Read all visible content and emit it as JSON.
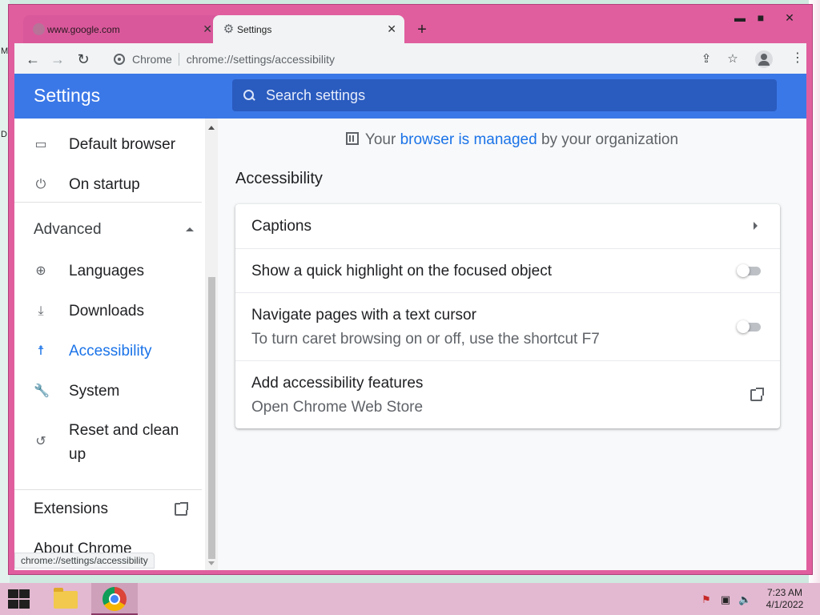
{
  "browser": {
    "tabs": [
      {
        "label": "www.google.com",
        "close": "✕"
      },
      {
        "label": "Settings",
        "close": "✕"
      }
    ],
    "new_tab": "+",
    "window_controls": {
      "minimize": "▬",
      "maximize": "■",
      "close": "✕"
    },
    "nav": {
      "back": "←",
      "forward": "→",
      "reload": "↻"
    },
    "omnibox": {
      "chip": "Chrome",
      "url": "chrome://settings/accessibility"
    },
    "actions": {
      "share": "⇪",
      "bookmark": "☆",
      "menu": "⋮"
    },
    "status_url": "chrome://settings/accessibility"
  },
  "settings": {
    "title": "Settings",
    "search_placeholder": "Search settings"
  },
  "sidebar": {
    "items": [
      {
        "label": "Default browser",
        "icon": "browser-window-icon",
        "glyph": "▭"
      },
      {
        "label": "On startup",
        "icon": "power-icon",
        "glyph": "⏻"
      },
      {
        "label": "Languages",
        "icon": "globe-icon",
        "glyph": "⊕"
      },
      {
        "label": "Downloads",
        "icon": "download-icon",
        "glyph": "⤓"
      },
      {
        "label": "Accessibility",
        "icon": "accessibility-icon",
        "glyph": "☨"
      },
      {
        "label": "System",
        "icon": "wrench-icon",
        "glyph": "🔧"
      },
      {
        "label": "Reset and clean",
        "label2": "up",
        "icon": "history-reset-icon",
        "glyph": "↺"
      }
    ],
    "advanced_label": "Advanced",
    "extensions_label": "Extensions",
    "about_label": "About Chrome"
  },
  "main": {
    "managed_prefix": "Your ",
    "managed_link": "browser is managed",
    "managed_suffix": " by your organization",
    "heading": "Accessibility",
    "rows": [
      {
        "title": "Captions"
      },
      {
        "title": "Show a quick highlight on the focused object",
        "toggle": false
      },
      {
        "title": "Navigate pages with a text cursor",
        "subtitle": "To turn caret browsing on or off, use the shortcut F7",
        "toggle": false
      },
      {
        "title": "Add accessibility features",
        "subtitle": "Open Chrome Web Store"
      }
    ]
  },
  "taskbar": {
    "time": "7:23 AM",
    "date": "4/1/2022"
  },
  "colors": {
    "header_blue": "#3b78e7",
    "accent_blue": "#1a73e8",
    "window_pink": "#e05e9e"
  }
}
